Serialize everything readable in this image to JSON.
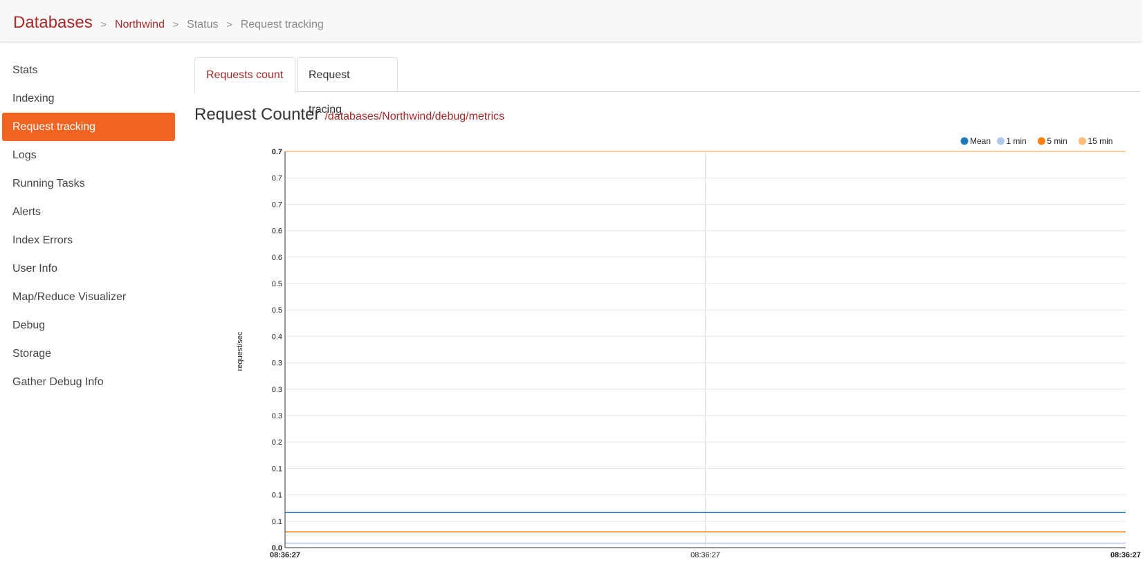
{
  "breadcrumb": {
    "root": "Databases",
    "separator": ">",
    "database": "Northwind",
    "section": "Status",
    "page": "Request tracking"
  },
  "sidebar": {
    "items": [
      {
        "label": "Stats",
        "active": false
      },
      {
        "label": "Indexing",
        "active": false
      },
      {
        "label": "Request tracking",
        "active": true
      },
      {
        "label": "Logs",
        "active": false
      },
      {
        "label": "Running Tasks",
        "active": false
      },
      {
        "label": "Alerts",
        "active": false
      },
      {
        "label": "Index Errors",
        "active": false
      },
      {
        "label": "User Info",
        "active": false
      },
      {
        "label": "Map/Reduce Visualizer",
        "active": false
      },
      {
        "label": "Debug",
        "active": false
      },
      {
        "label": "Storage",
        "active": false
      },
      {
        "label": "Gather Debug Info",
        "active": false
      }
    ]
  },
  "tabs": [
    {
      "label": "Requests count",
      "active": true
    },
    {
      "label": "Request tracing",
      "active": false
    }
  ],
  "heading": {
    "title": "Request Counter",
    "url": "/databases/Northwind/debug/metrics"
  },
  "colors": {
    "accent": "#a52a2a",
    "active_nav": "#f26422"
  },
  "chart_data": {
    "type": "line",
    "ylabel": "request/sec",
    "xlabel": "",
    "ylim": [
      0.0,
      0.7
    ],
    "y_ticks": [
      "0.7",
      "0.7",
      "0.7",
      "0.6",
      "0.6",
      "0.5",
      "0.5",
      "0.4",
      "0.3",
      "0.3",
      "0.3",
      "0.2",
      "0.1",
      "0.1",
      "0.1",
      "0.0"
    ],
    "x_ticks": [
      "08:36:27",
      "08:36:27",
      "08:36:27"
    ],
    "grid": true,
    "legend": "top-right",
    "series": [
      {
        "name": "Mean",
        "color": "#1f77b4",
        "values": [
          0.062,
          0.062,
          0.062
        ]
      },
      {
        "name": "1 min",
        "color": "#aec7e8",
        "values": [
          0.008,
          0.008,
          0.008
        ]
      },
      {
        "name": "5 min",
        "color": "#ff7f0e",
        "values": [
          0.028,
          0.028,
          0.028
        ]
      },
      {
        "name": "15 min",
        "color": "#ffbb78",
        "values": [
          0.7,
          0.7,
          0.7
        ]
      }
    ]
  }
}
